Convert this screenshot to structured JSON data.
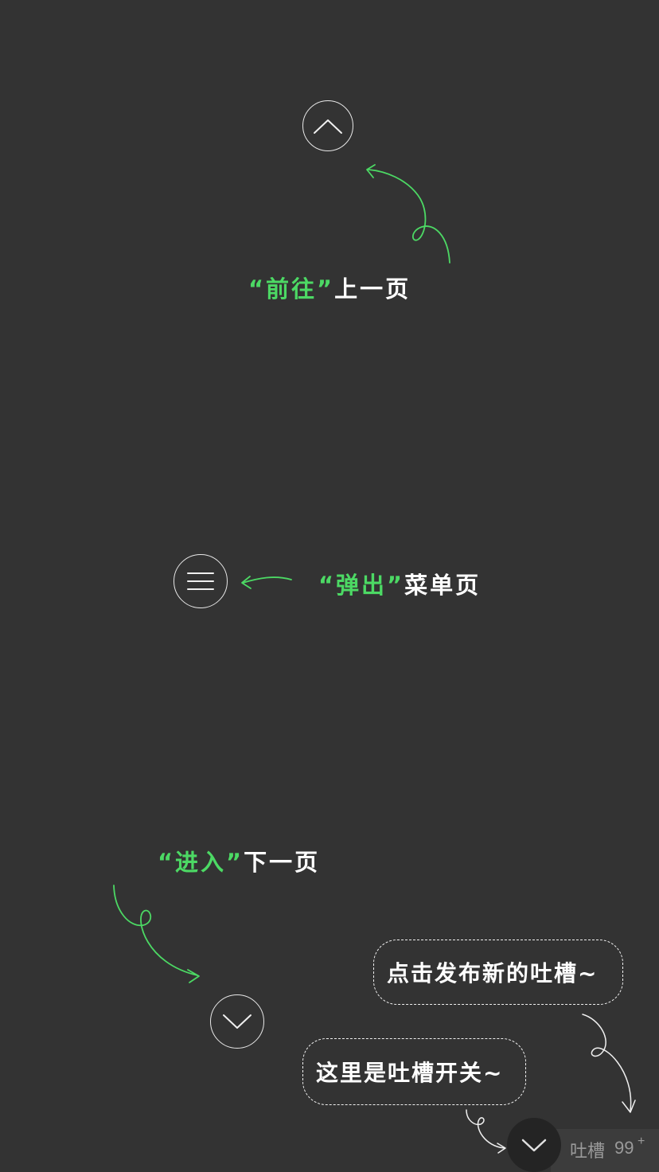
{
  "prev": {
    "accent": "“前往”",
    "rest": "上一页",
    "icon": "chevron-up-icon"
  },
  "menu": {
    "accent": "“弹出”",
    "rest": "菜单页",
    "icon": "hamburger-menu-icon"
  },
  "next": {
    "accent": "“进入”",
    "rest": "下一页",
    "icon": "chevron-down-icon"
  },
  "bubbles": {
    "publish": "点击发布新的吐槽~",
    "toggle": "这里是吐槽开关~"
  },
  "comment_bar": {
    "label": "吐槽",
    "count": "99",
    "plus": "+",
    "icon": "chevron-down-icon"
  },
  "colors": {
    "background": "#333333",
    "accent_green": "#4cd964",
    "text": "#ffffff",
    "muted": "#9a9a9a"
  }
}
